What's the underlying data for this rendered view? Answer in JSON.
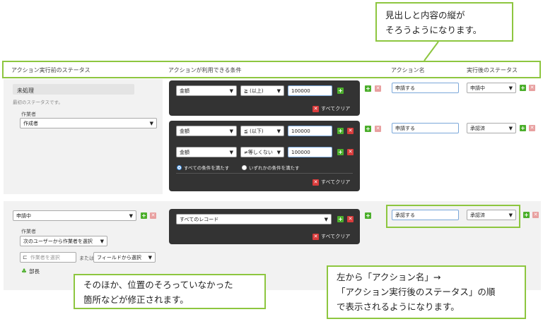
{
  "callouts": {
    "top": [
      "見出しと内容の縦が",
      "そろうようになります。"
    ],
    "bottom_left": [
      "そのほか、位置のそろっていなかった",
      "箇所などが修正されます。"
    ],
    "bottom_right": [
      "左から「アクション名」→",
      "「アクション実行後のステータス」の順",
      "で表示されるようになります。"
    ]
  },
  "headers": {
    "col1": "アクション実行前のステータス",
    "col2": "アクションが利用できる条件",
    "col3": "アクション名",
    "col4": "実行後のステータス"
  },
  "row1": {
    "status": "未処理",
    "status_note": "最初のステータスです。",
    "assignee_label": "作業者",
    "assignee_value": "作成者",
    "cond1": {
      "field": "金額",
      "op": "≧ (以上)",
      "value": "100000",
      "clear": "すべてクリア"
    },
    "action1": {
      "name": "申請する",
      "next": "申請中"
    },
    "cond2a": {
      "field": "金額",
      "op": "≦ (以下)",
      "value": "100000"
    },
    "cond2b": {
      "field": "金額",
      "op": "≠等しくない",
      "value": "100000"
    },
    "radio_all": "すべての条件を満たす",
    "radio_any": "いずれかの条件を満たす",
    "clear2": "すべてクリア",
    "action2": {
      "name": "申請する",
      "next": "承認済"
    }
  },
  "row2": {
    "status": "申請中",
    "assignee_label": "作業者",
    "assignee_mode": "次のユーザーから作業者を選択",
    "pick_placeholder": "作業者を選択",
    "or_text": "または",
    "field_select": "フィールドから選択",
    "dept": "部長",
    "cond": "すべてのレコード",
    "clear": "すべてクリア",
    "action": {
      "name": "承認する",
      "next": "承認済"
    }
  },
  "colors": {
    "accent_green": "#8dc63f",
    "panel_dark": "#333333",
    "add_green": "#4caf2c",
    "delete_red": "#d93c3c"
  }
}
